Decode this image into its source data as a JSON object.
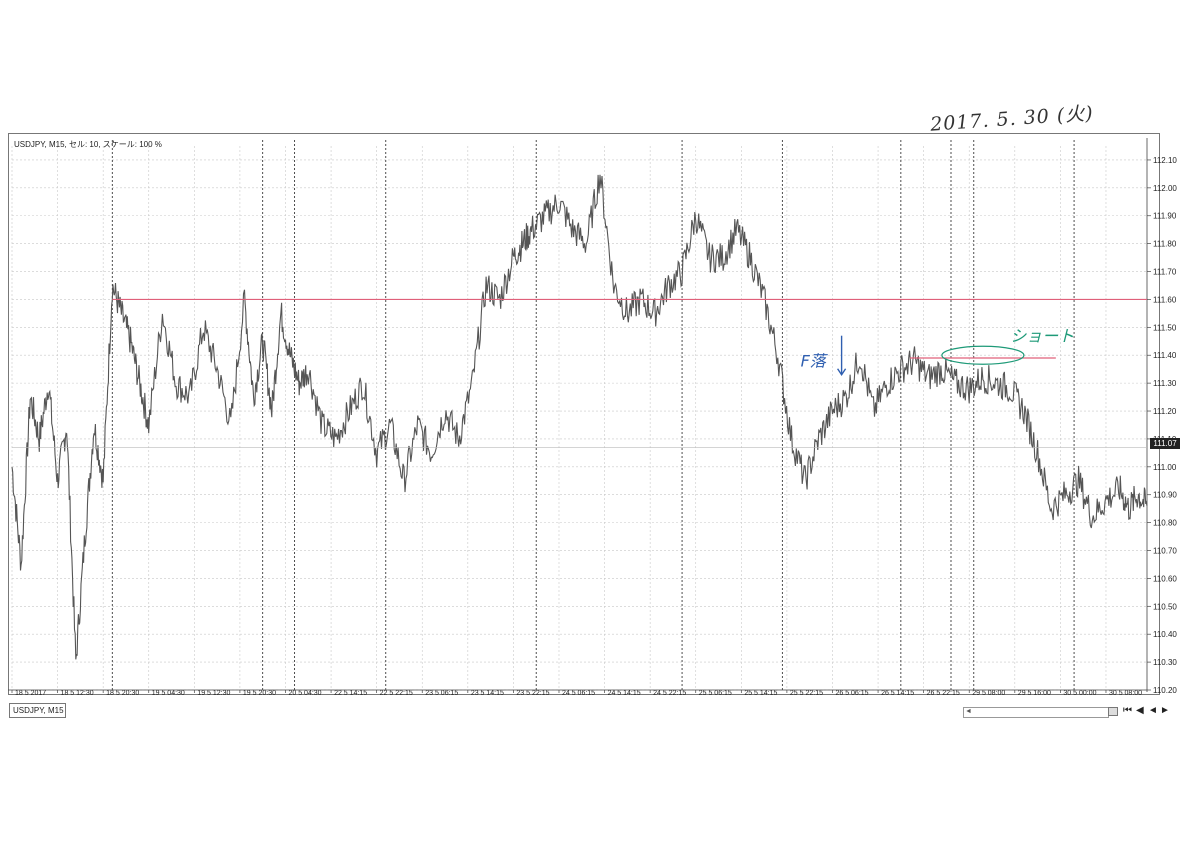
{
  "handwritten_date": "2017. 5. 30 (火)",
  "chart_header": "USDJPY, M15, セル: 10, スケール: 100 %",
  "symbol_tab": "USDJPY, M15",
  "last_price_label": "111.07",
  "navigation": {
    "scroll_left": "◄",
    "first": "⏮",
    "prev_page": "◀",
    "prev": "◄",
    "next": "►"
  },
  "chart_data": {
    "type": "line",
    "title": "USDJPY, M15, セル: 10, スケール: 100 %",
    "xlabel": "",
    "ylabel": "",
    "ylim": [
      110.2,
      112.15
    ],
    "grid": true,
    "line_color": "#555555",
    "y_ticks": [
      "112.10",
      "112.00",
      "111.90",
      "111.80",
      "111.70",
      "111.60",
      "111.50",
      "111.40",
      "111.30",
      "111.20",
      "111.10",
      "111.00",
      "110.90",
      "110.80",
      "110.70",
      "110.60",
      "110.50",
      "110.40",
      "110.30",
      "110.20"
    ],
    "x_tick_labels": [
      "18 5 2017",
      "18 5 12:30",
      "18 5 20:30",
      "19 5 04:30",
      "19 5 12:30",
      "19 5 20:30",
      "20 5 04:30",
      "22 5 14:15",
      "22 5 22:15",
      "23 5 06:15",
      "23 5 14:15",
      "23 5 22:15",
      "24 5 06:15",
      "24 5 14:15",
      "24 5 22:15",
      "25 5 06:15",
      "25 5 14:15",
      "25 5 22:15",
      "26 5 06:15",
      "26 5 14:15",
      "26 5 22:15",
      "29 5 08:00",
      "29 5 16:00",
      "30 5 00:00",
      "30 5 08:00"
    ],
    "x_tick_positions": [
      0,
      1,
      2,
      3,
      4,
      5,
      6,
      7,
      8,
      9,
      10,
      11,
      12,
      13,
      14,
      15,
      16,
      17,
      18,
      19,
      20,
      21,
      22,
      23,
      24
    ],
    "day_separators": [
      2.2,
      5.5,
      6.2,
      8.2,
      11.5,
      14.7,
      16.9,
      19.5,
      20.6,
      21.1,
      23.3
    ],
    "series": [
      {
        "x": [
          0,
          0.2,
          0.4,
          0.6,
          0.8,
          1.0,
          1.2,
          1.4,
          1.6,
          1.8,
          2.0,
          2.2,
          2.4,
          2.6,
          2.8,
          3.0,
          3.3,
          3.6,
          3.9,
          4.2,
          4.5,
          4.8,
          5.1,
          5.3,
          5.5,
          5.7,
          5.9,
          6.1,
          6.3,
          6.5,
          6.8,
          7.1,
          7.4,
          7.7,
          8.0,
          8.3,
          8.6,
          8.9,
          9.2,
          9.5,
          9.8,
          10.1,
          10.4,
          10.7,
          11.0,
          11.2,
          11.4,
          11.7,
          12.0,
          12.3,
          12.6,
          12.9,
          13.2,
          13.5,
          13.8,
          14.1,
          14.4,
          14.7,
          15.0,
          15.3,
          15.6,
          15.9,
          16.2,
          16.5,
          16.8,
          17.1,
          17.4,
          17.7,
          18.0,
          18.3,
          18.6,
          18.9,
          19.2,
          19.5,
          19.8,
          20.1,
          20.4,
          20.7,
          21.0,
          21.3,
          21.6,
          21.9,
          22.2,
          22.5,
          22.8,
          23.1,
          23.4,
          23.7,
          24.0,
          24.3,
          24.5,
          24.7,
          24.9
        ],
        "values": [
          111.0,
          110.65,
          111.25,
          111.1,
          111.3,
          110.95,
          111.15,
          110.3,
          110.75,
          111.15,
          110.95,
          111.65,
          111.55,
          111.45,
          111.3,
          111.15,
          111.55,
          111.3,
          111.25,
          111.5,
          111.35,
          111.15,
          111.6,
          111.25,
          111.45,
          111.2,
          111.55,
          111.4,
          111.3,
          111.35,
          111.15,
          111.1,
          111.2,
          111.3,
          111.05,
          111.15,
          110.95,
          111.15,
          111.05,
          111.2,
          111.1,
          111.3,
          111.65,
          111.6,
          111.75,
          111.8,
          111.85,
          111.9,
          111.95,
          111.85,
          111.8,
          112.05,
          111.65,
          111.55,
          111.6,
          111.55,
          111.65,
          111.7,
          111.9,
          111.75,
          111.75,
          111.85,
          111.75,
          111.6,
          111.4,
          111.1,
          110.95,
          111.1,
          111.2,
          111.25,
          111.4,
          111.2,
          111.3,
          111.35,
          111.38,
          111.32,
          111.35,
          111.3,
          111.28,
          111.32,
          111.3,
          111.28,
          111.2,
          111.05,
          110.85,
          110.9,
          110.95,
          110.82,
          110.88,
          110.92,
          110.85,
          110.9,
          110.86
        ]
      }
    ],
    "annotations": [
      {
        "type": "hline",
        "y": 111.6,
        "x_start": 2.2,
        "x_end": 24.9,
        "color": "#e0607a"
      },
      {
        "type": "hline",
        "y": 111.39,
        "x_start": 19.7,
        "x_end": 22.9,
        "color": "#e0607a"
      },
      {
        "type": "text",
        "text": "ショート",
        "x": 21.9,
        "y": 111.45,
        "color": "#1e9a78"
      },
      {
        "type": "ellipse",
        "x": 21.3,
        "y": 111.4,
        "color": "#1e9a78"
      },
      {
        "type": "text",
        "text": "F落",
        "x": 17.3,
        "y": 111.36,
        "color": "#2f5fb0"
      },
      {
        "type": "arrow",
        "x": 18.2,
        "y_from": 111.47,
        "y_to": 111.33,
        "color": "#2f5fb0"
      }
    ]
  }
}
